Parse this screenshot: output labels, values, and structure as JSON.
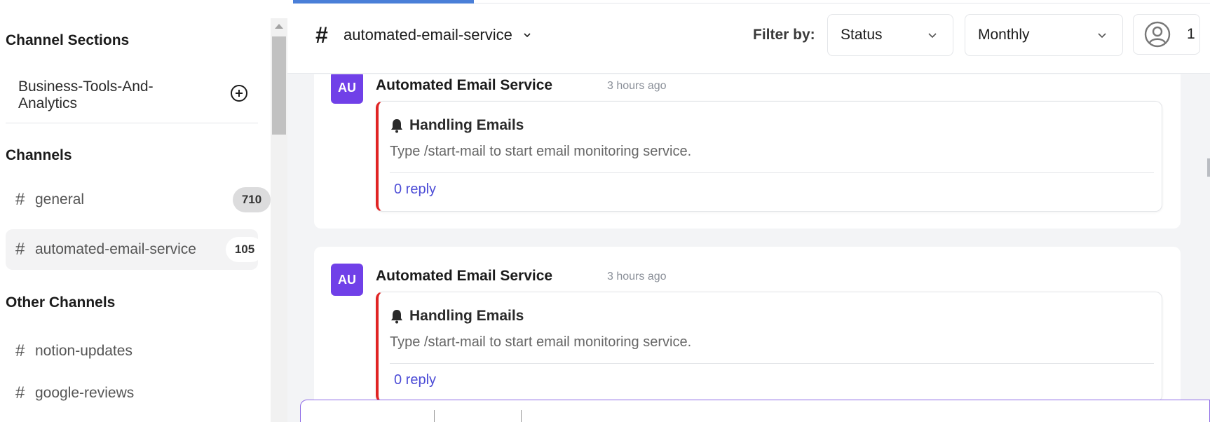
{
  "sidebar": {
    "sections_heading": "Channel Sections",
    "section_item": {
      "label": "Business-Tools-And-Analytics"
    },
    "channels_heading": "Channels",
    "channels": [
      {
        "name": "general",
        "count": "710"
      },
      {
        "name": "automated-email-service",
        "count": "105"
      }
    ],
    "other_heading": "Other Channels",
    "other_channels": [
      {
        "name": "notion-updates"
      },
      {
        "name": "google-reviews"
      }
    ],
    "hash_symbol": "#"
  },
  "header": {
    "channel_hash": "#",
    "channel_name": "automated-email-service",
    "filter_label": "Filter by:",
    "status_dropdown": "Status",
    "period_dropdown": "Monthly",
    "user_count": "1"
  },
  "messages": [
    {
      "avatar": "AU",
      "sender": "Automated Email Service",
      "time": "3 hours ago",
      "embed_title": "Handling Emails",
      "embed_desc": "Type /start-mail to start email monitoring service.",
      "reply": "0 reply"
    },
    {
      "avatar": "AU",
      "sender": "Automated Email Service",
      "time": "3 hours ago",
      "embed_title": "Handling Emails",
      "embed_desc": "Type /start-mail to start email monitoring service.",
      "reply": "0 reply"
    }
  ],
  "colors": {
    "accent_purple": "#7040e8",
    "embed_border_red": "#e02424",
    "link_blue": "#4b4bd6",
    "tab_blue": "#4a7fd8"
  },
  "icons": [
    "plus-circle-icon",
    "chevron-down-icon",
    "user-circle-icon",
    "bell-icon"
  ]
}
